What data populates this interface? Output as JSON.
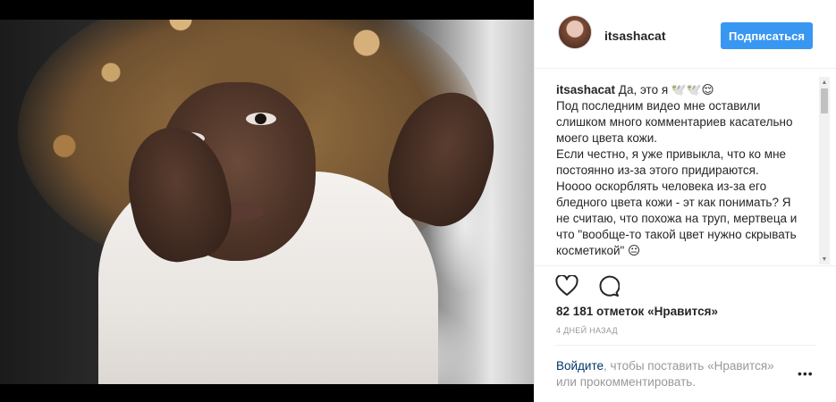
{
  "post": {
    "carousel": {
      "count": 3,
      "active_index": 0
    }
  },
  "header": {
    "username": "itsashacat",
    "follow_label": "Подписаться"
  },
  "caption": {
    "username": "itsashacat",
    "text": " Да, это я 🕊️🕊️😌\nПод последним видео мне оставили слишком много комментариев касательно моего цвета кожи.\nЕсли честно, я уже привыкла, что ко мне постоянно из-за этого придираются.\nНоооо оскорблять человека из-за его бледного цвета кожи - эт как понимать? Я не считаю, что похожа на труп, мертвеца и что \"вообще-то такой цвет нужно скрывать косметикой\" 😐"
  },
  "actions": {
    "like_icon": "heart-icon",
    "comment_icon": "comment-icon"
  },
  "likes_text": "82 181 отметок «Нравится»",
  "time_text": "4 дней назад",
  "login": {
    "link_text": "Войдите",
    "rest_text": ", чтобы поставить «Нравится» или прокомментировать.",
    "more_label": "•••"
  },
  "colors": {
    "accent": "#3897f0",
    "text": "#262626",
    "muted": "#999999",
    "link": "#003569"
  }
}
